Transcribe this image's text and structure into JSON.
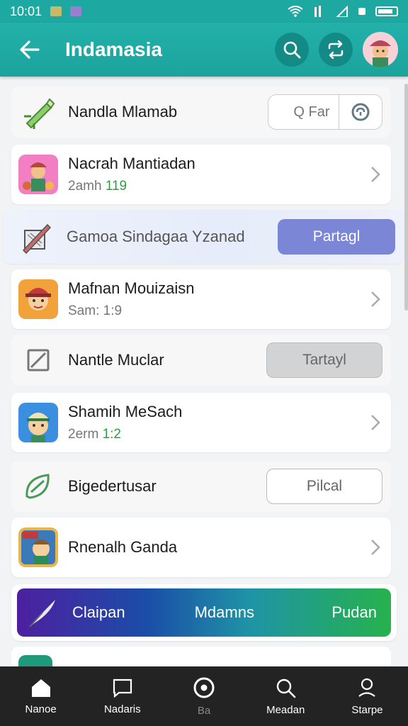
{
  "status_bar": {
    "time": "10:01"
  },
  "app_bar": {
    "title": "Indamasia"
  },
  "list": [
    {
      "title": "Nandla Mlamab",
      "search_text": "Q Far"
    },
    {
      "title": "Nacrah Mantiadan",
      "sub_prefix": "2amh ",
      "sub_accent": "119"
    },
    {
      "title": "Gamoa Sindagaa Yzanad",
      "button": "Partagl"
    },
    {
      "title": "Mafnan Mouizaisn",
      "sub": "Sam: 1:9"
    },
    {
      "title": "Nantle Muclar",
      "button": "Tartayl"
    },
    {
      "title": "Shamih MeSach",
      "sub_prefix": "2erm ",
      "sub_accent": "1:2"
    },
    {
      "title": "Bigedertusar",
      "button": "Pilcal"
    },
    {
      "title": "Rnenalh Ganda"
    }
  ],
  "banner": {
    "left": "Claipan",
    "middle": "Mdamns",
    "right": "Pudan"
  },
  "bottom_nav": [
    {
      "label": "Nanoe"
    },
    {
      "label": "Nadaris"
    },
    {
      "label": "Ba"
    },
    {
      "label": "Meadan"
    },
    {
      "label": "Starpe"
    }
  ],
  "colors": {
    "primary": "#1ea8a2",
    "accent_button": "#7b86d6",
    "nav_bg": "#232323"
  }
}
